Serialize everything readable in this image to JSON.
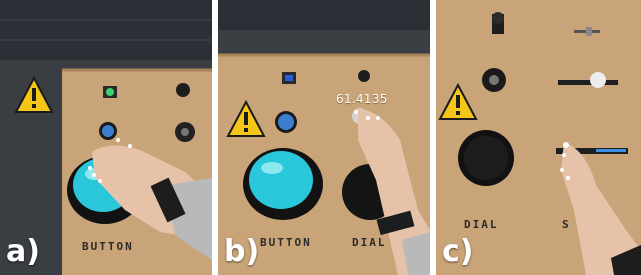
{
  "panels": [
    {
      "letter": "a)",
      "board_text": "BUTTON"
    },
    {
      "letter": "b)",
      "board_text_1": "BUTTON",
      "board_text_2": "DIAL",
      "overlay": "61.4135"
    },
    {
      "letter": "c)",
      "board_text_1": "DIAL",
      "board_text_2": "S"
    }
  ],
  "colors": {
    "cardboard": "#c9a478",
    "cyan": "#29c7d9",
    "warning_yellow": "#f5c518",
    "floor": "#3a3d42"
  },
  "icons": [
    "warning-icon",
    "button-icon",
    "dial-icon",
    "slider-icon"
  ]
}
